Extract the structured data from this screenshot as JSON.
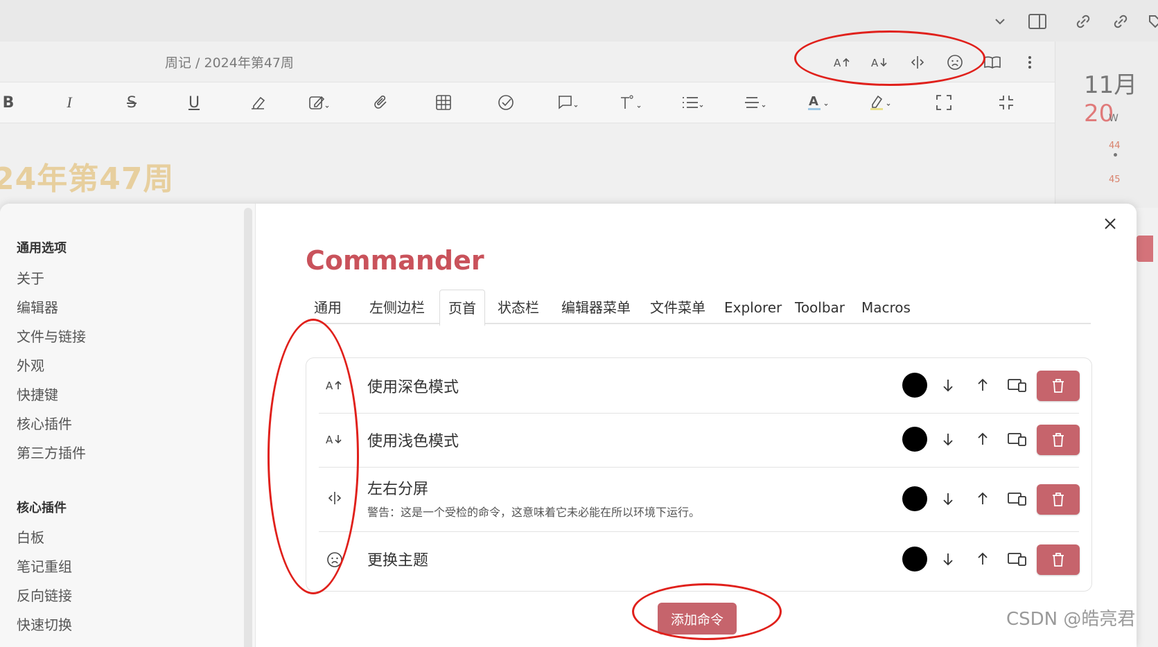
{
  "breadcrumb": "周记 / 2024年第47周",
  "note_title": "24年第47周",
  "calendar": {
    "month": "11月",
    "year": "20",
    "weekday": "W",
    "weeks": [
      "44",
      "45"
    ]
  },
  "commander": {
    "title": "Commander",
    "tabs": [
      "通用",
      "左侧边栏",
      "页首",
      "状态栏",
      "编辑器菜单",
      "文件菜单",
      "Explorer",
      "Toolbar",
      "Macros"
    ],
    "active_tab": "页首",
    "rows": [
      {
        "icon": "font-size-increase-icon",
        "label": "使用深色模式",
        "warning": ""
      },
      {
        "icon": "font-size-decrease-icon",
        "label": "使用浅色模式",
        "warning": ""
      },
      {
        "icon": "split-view-icon",
        "label": "左右分屏",
        "warning": "警告：这是一个受检的命令，这意味着它未必能在所以环境下运行。"
      },
      {
        "icon": "frown-face-icon",
        "label": "更换主题",
        "warning": ""
      }
    ],
    "add_button": "添加命令"
  },
  "settings_sidebar": {
    "sections": [
      {
        "heading": "通用选项",
        "items": [
          "关于",
          "编辑器",
          "文件与链接",
          "外观",
          "快捷键",
          "核心插件",
          "第三方插件"
        ]
      },
      {
        "heading": "核心插件",
        "items": [
          "白板",
          "笔记重组",
          "反向链接",
          "快速切换"
        ]
      }
    ]
  },
  "colors": {
    "accent": "#c9525b",
    "button": "#c6646c",
    "annotation": "#e0201b"
  },
  "watermark": "CSDN @皓亮君"
}
